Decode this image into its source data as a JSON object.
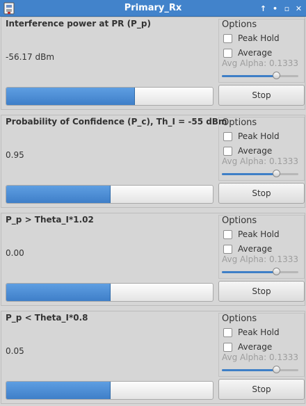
{
  "window": {
    "title": "Primary_Rx",
    "controls": [
      "↑",
      "•",
      "▫",
      "✕"
    ]
  },
  "panels": [
    {
      "title": "Interference power at PR (P_p)",
      "value": "-56.17 dBm",
      "progress": 0.62,
      "options": {
        "label": "Options",
        "peak_hold_label": "Peak Hold",
        "peak_hold_checked": false,
        "average_label": "Average",
        "average_checked": false,
        "avg_alpha_label": "Avg Alpha: 0.1333",
        "slider_level": 0.71
      },
      "stop_label": "Stop"
    },
    {
      "title": "Probability of Confidence (P_c), Th_I = -55 dBm",
      "value": "0.95",
      "progress": 0.5,
      "options": {
        "label": "Options",
        "peak_hold_label": "Peak Hold",
        "peak_hold_checked": false,
        "average_label": "Average",
        "average_checked": false,
        "avg_alpha_label": "Avg Alpha: 0.1333",
        "slider_level": 0.71
      },
      "stop_label": "Stop"
    },
    {
      "title": "P_p > Theta_I*1.02",
      "value": "0.00",
      "progress": 0.5,
      "options": {
        "label": "Options",
        "peak_hold_label": "Peak Hold",
        "peak_hold_checked": false,
        "average_label": "Average",
        "average_checked": false,
        "avg_alpha_label": "Avg Alpha: 0.1333",
        "slider_level": 0.71
      },
      "stop_label": "Stop"
    },
    {
      "title": "P_p < Theta_I*0.8",
      "value": "0.05",
      "progress": 0.5,
      "options": {
        "label": "Options",
        "peak_hold_label": "Peak Hold",
        "peak_hold_checked": false,
        "average_label": "Average",
        "average_checked": false,
        "avg_alpha_label": "Avg Alpha: 0.1333",
        "slider_level": 0.71
      },
      "stop_label": "Stop"
    }
  ],
  "colors": {
    "titlebar": "#4283cb",
    "accent": "#3e7fc7",
    "background": "#d6d6d6"
  }
}
